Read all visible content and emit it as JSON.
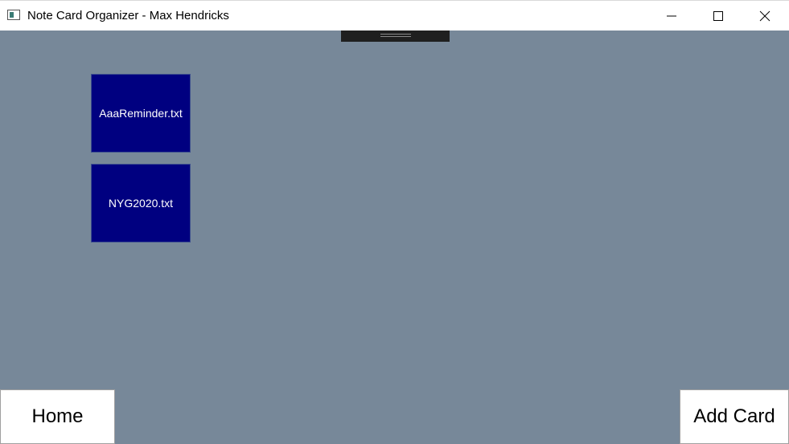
{
  "window": {
    "title": "Note Card Organizer - Max Hendricks",
    "icon": "app-window-icon",
    "controls": [
      "minimize-icon",
      "maximize-icon",
      "close-icon"
    ]
  },
  "colors": {
    "background": "#778899",
    "card": "#000080",
    "card_text": "#ffffff",
    "titlebar": "#ffffff"
  },
  "cards": [
    {
      "label": "AaaReminder.txt"
    },
    {
      "label": "NYG2020.txt"
    }
  ],
  "buttons": {
    "home_label": "Home",
    "add_card_label": "Add Card"
  }
}
